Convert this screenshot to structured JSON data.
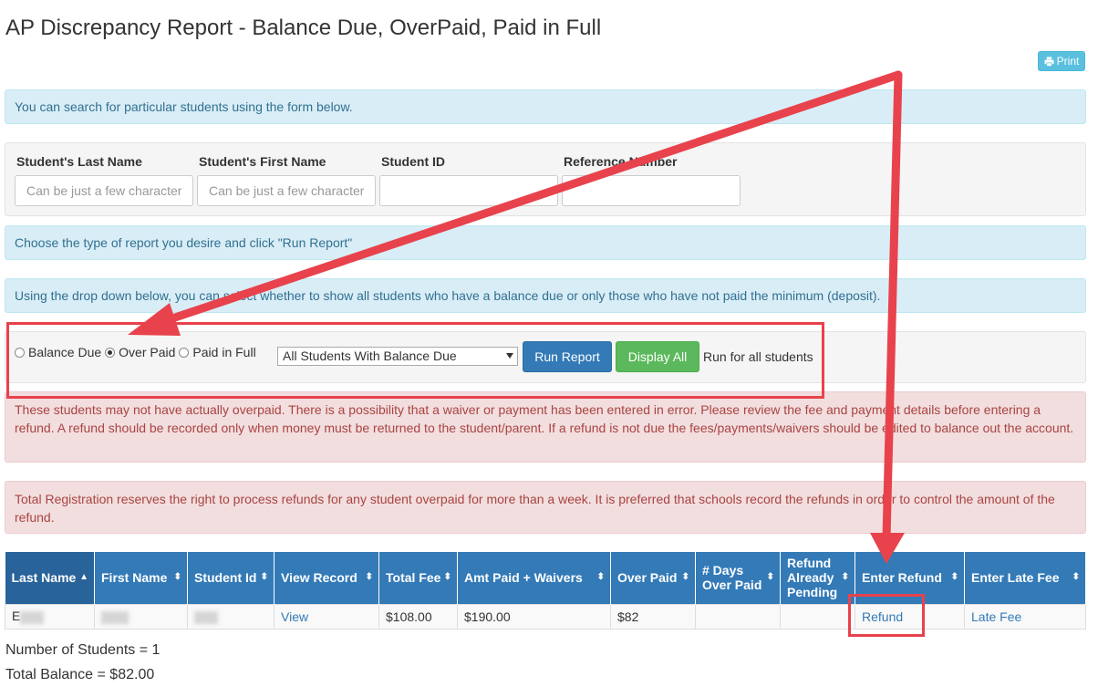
{
  "page": {
    "title": "AP Discrepancy Report - Balance Due, OverPaid, Paid in Full",
    "print_label": "Print"
  },
  "search": {
    "info": "You can search for particular students using the form below.",
    "fields": [
      {
        "label": "Student's Last Name",
        "placeholder": "Can be just a few characters",
        "value": ""
      },
      {
        "label": "Student's First Name",
        "placeholder": "Can be just a few characters",
        "value": ""
      },
      {
        "label": "Student ID",
        "placeholder": "",
        "value": ""
      },
      {
        "label": "Reference Number",
        "placeholder": "",
        "value": ""
      }
    ]
  },
  "report_type": {
    "info": "Choose the type of report you desire and click \"Run Report\"",
    "dropdown_info": "Using the drop down below, you can select whether to show all students who have a balance due or only those who have not paid the minimum (deposit).",
    "options": [
      {
        "label": "Balance Due",
        "checked": false
      },
      {
        "label": "Over Paid",
        "checked": true
      },
      {
        "label": "Paid in Full",
        "checked": false
      }
    ],
    "select_value": "All Students With Balance Due",
    "run_button": "Run Report",
    "display_all_button": "Display All",
    "run_all_text": "Run for all students"
  },
  "warnings": {
    "overpaid": "These students may not have actually overpaid. There is a possibility that a waiver or payment has been entered in error. Please review the fee and payment details before entering a refund. A refund should be recorded only when money must be returned to the student/parent. If a refund is not due the fees/payments/waivers should be edited to balance out the account.",
    "refund_policy": "Total Registration reserves the right to process refunds for any student overpaid for more than a week. It is preferred that schools record the refunds in order to control the amount of the refund."
  },
  "table": {
    "columns": [
      "Last Name",
      "First Name",
      "Student Id",
      "View Record",
      "Total Fee",
      "Amt Paid + Waivers",
      "Over Paid",
      "# Days Over Paid",
      "Refund Already Pending",
      "Enter Refund",
      "Enter Late Fee"
    ],
    "rows": [
      {
        "last_name": "E",
        "first_name": "",
        "student_id": "",
        "view": "View",
        "total_fee": "$108.00",
        "amt_paid": "$190.00",
        "over_paid": "$82",
        "days": "",
        "pending": "",
        "refund": "Refund",
        "late_fee": "Late Fee"
      }
    ]
  },
  "summary": {
    "count": "Number of Students = 1",
    "balance": "Total Balance = $82.00"
  },
  "colors": {
    "annotation": "#e8424c",
    "header": "#337ab7",
    "info_bg": "#d9edf7",
    "danger_bg": "#f2dede"
  }
}
